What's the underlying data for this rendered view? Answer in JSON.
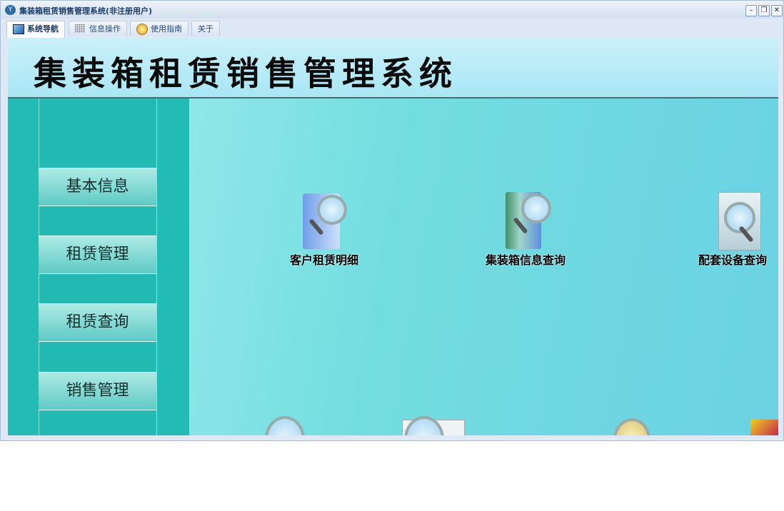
{
  "window": {
    "title": "集装箱租赁销售管理系统(非注册用户)",
    "minimize": "–",
    "restore": "❐",
    "close": "✕"
  },
  "tabs": [
    {
      "label": "系统导航",
      "icon": "monitor-icon"
    },
    {
      "label": "信息操作",
      "icon": "grid-icon"
    },
    {
      "label": "使用指南",
      "icon": "help-icon"
    },
    {
      "label": "关于",
      "icon": ""
    }
  ],
  "banner": {
    "title": "集装箱租赁销售管理系统"
  },
  "sidebar": {
    "items": [
      {
        "label": "基本信息"
      },
      {
        "label": "租赁管理"
      },
      {
        "label": "租赁查询"
      },
      {
        "label": "销售管理"
      }
    ]
  },
  "main": {
    "items": [
      {
        "label": "客户租赁明细",
        "icon": "documents-search-icon"
      },
      {
        "label": "集装箱信息查询",
        "icon": "book-search-icon"
      },
      {
        "label": "配套设备查询",
        "icon": "page-search-icon"
      }
    ]
  }
}
